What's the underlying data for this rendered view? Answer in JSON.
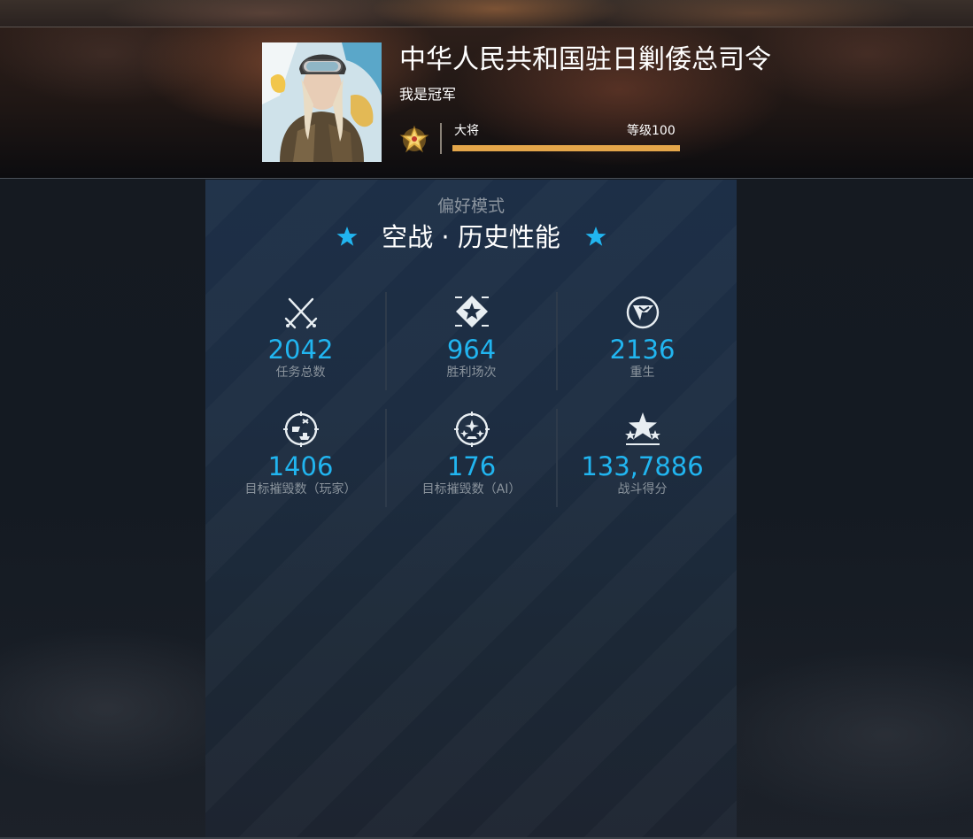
{
  "player": {
    "name": "中华人民共和国驻日剿倭总司令",
    "subtitle": "我是冠军",
    "rank": "大将",
    "level_label": "等级100",
    "level_progress": 1.0,
    "avatar_icon": "player-avatar-portrait"
  },
  "mode": {
    "label": "偏好模式",
    "title": "空战 · 历史性能",
    "star_icon": "star-icon"
  },
  "stats": [
    {
      "icon": "crossed-swords-icon",
      "value": "2042",
      "label": "任务总数"
    },
    {
      "icon": "victory-star-icon",
      "value": "964",
      "label": "胜利场次"
    },
    {
      "icon": "respawn-flag-icon",
      "value": "2136",
      "label": "重生"
    },
    {
      "icon": "target-ship-icon",
      "value": "1406",
      "label": "目标摧毁数（玩家）"
    },
    {
      "icon": "target-planes-icon",
      "value": "176",
      "label": "目标摧毁数（AI）"
    },
    {
      "icon": "score-stars-icon",
      "value": "133,7886",
      "label": "战斗得分"
    }
  ],
  "colors": {
    "accent": "#21b5f0",
    "progress": "#e4a64a",
    "label": "#8a939c"
  }
}
